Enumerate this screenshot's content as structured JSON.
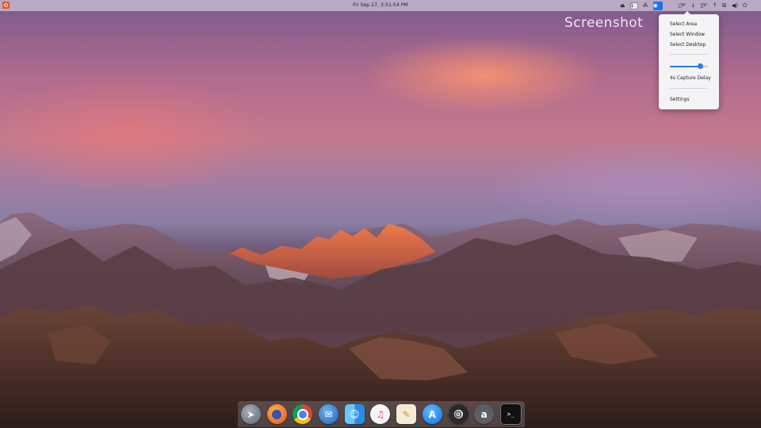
{
  "topbar": {
    "clock": "Fri Sep 27,  3:51:54 PM",
    "workspace": "1",
    "tray": [
      {
        "icon": "eject-icon"
      },
      {
        "icon": "workspace-indicator",
        "label": "1"
      },
      {
        "icon": "network-dots-icon"
      },
      {
        "icon": "screenshot-tool-icon"
      },
      {
        "icon": "temperature-icon",
        "label": "9°"
      },
      {
        "icon": "download-arrow-icon"
      },
      {
        "icon": "stat-icon",
        "label": "9°"
      },
      {
        "icon": "wifi-icon"
      },
      {
        "icon": "network-icon"
      },
      {
        "icon": "volume-icon"
      },
      {
        "icon": "power-icon"
      }
    ]
  },
  "watermark": "Screenshot",
  "screenshot_menu": {
    "items": [
      "Select Area",
      "Select Window",
      "Select Desktop"
    ],
    "delay_label": "4s Capture Delay",
    "delay_slider_level": 0.8,
    "settings_label": "Settings"
  },
  "dock": {
    "apps": [
      {
        "name": "launchpad",
        "icon": "rocket-icon",
        "glyph": "➤"
      },
      {
        "name": "firefox",
        "icon": "firefox-icon",
        "glyph": "●"
      },
      {
        "name": "chrome",
        "icon": "chrome-icon",
        "glyph": "◉"
      },
      {
        "name": "thunderbird",
        "icon": "thunderbird-icon",
        "glyph": "✉"
      },
      {
        "name": "finder",
        "icon": "finder-icon",
        "glyph": "☺"
      },
      {
        "name": "music",
        "icon": "music-icon",
        "glyph": "♫"
      },
      {
        "name": "notes",
        "icon": "notes-icon",
        "glyph": "✎"
      },
      {
        "name": "app-store",
        "icon": "app-store-icon",
        "glyph": "A"
      },
      {
        "name": "system-settings",
        "icon": "gear-icon",
        "glyph": "⚙"
      },
      {
        "name": "amazon",
        "icon": "amazon-icon",
        "glyph": "a"
      },
      {
        "name": "terminal",
        "icon": "terminal-icon",
        "glyph": ">_"
      }
    ]
  },
  "colors": {
    "accent": "#2a7de1",
    "ubuntu_orange": "#e95420"
  }
}
